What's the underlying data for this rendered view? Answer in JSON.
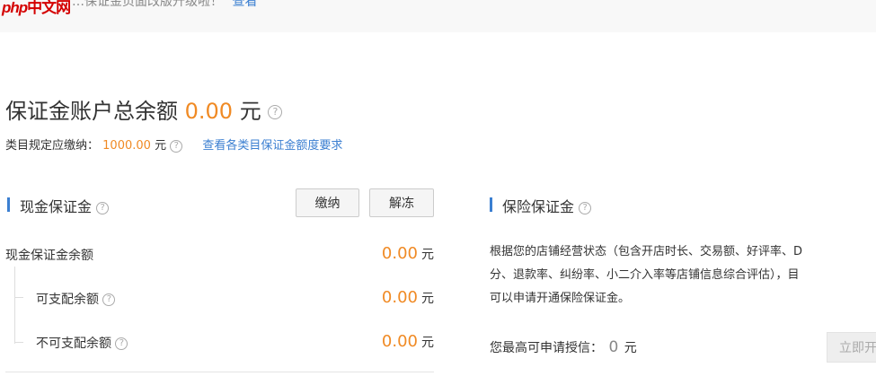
{
  "topbar": {
    "logo_php": "php",
    "logo_cn": "中文网",
    "notice_text": "…保证金页面改版升级啦！",
    "notice_link": "查看"
  },
  "summary": {
    "title": "保证金账户总余额",
    "amount": "0.00",
    "unit": "元",
    "category_label": "类目规定应缴纳：",
    "category_amount": "1000.00",
    "category_unit": "元",
    "requirement_link": "查看各类目保证金额度要求"
  },
  "cash": {
    "title": "现金保证金",
    "pay_button": "缴纳",
    "unfreeze_button": "解冻",
    "rows": [
      {
        "label": "现金保证金余额",
        "amount": "0.00",
        "unit": "元"
      },
      {
        "label": "可支配余额",
        "amount": "0.00",
        "unit": "元"
      },
      {
        "label": "不可支配余额",
        "amount": "0.00",
        "unit": "元"
      }
    ]
  },
  "insurance": {
    "title": "保险保证金",
    "description": "根据您的店铺经营状态（包含开店时长、交易额、好评率、D\n分、退款率、纠纷率、小二介入率等店铺信息综合评估），目\n可以申请开通保险保证金。",
    "credit_label": "您最高可申请授信：",
    "credit_amount": "0",
    "credit_unit": "元",
    "apply_button": "立即开"
  },
  "help_icon": "question-circle-icon",
  "colors": {
    "accent": "#3b7fd1",
    "amount": "#f08a24"
  }
}
